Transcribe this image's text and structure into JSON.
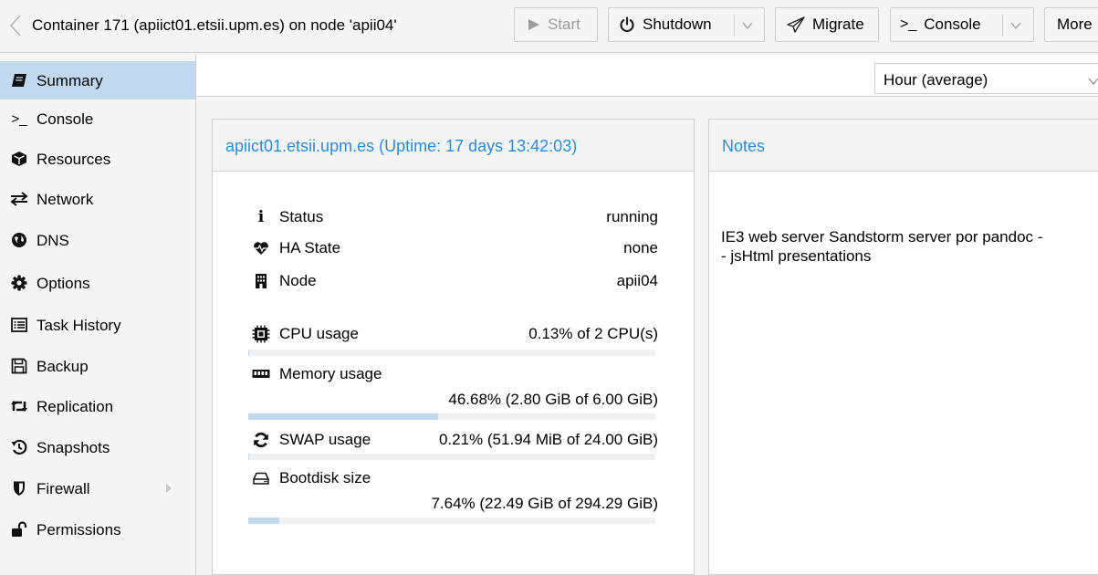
{
  "header": {
    "title": "Container 171 (apiict01.etsii.upm.es) on node 'apii04'",
    "buttons": {
      "start": "Start",
      "shutdown": "Shutdown",
      "migrate": "Migrate",
      "console": "Console",
      "more": "More"
    }
  },
  "sidebar": {
    "items": [
      {
        "label": "Summary",
        "icon": "book-icon"
      },
      {
        "label": "Console",
        "icon": "terminal-icon"
      },
      {
        "label": "Resources",
        "icon": "cube-icon"
      },
      {
        "label": "Network",
        "icon": "exchange-icon"
      },
      {
        "label": "DNS",
        "icon": "globe-icon"
      },
      {
        "label": "Options",
        "icon": "gear-icon"
      },
      {
        "label": "Task History",
        "icon": "list-icon"
      },
      {
        "label": "Backup",
        "icon": "floppy-icon"
      },
      {
        "label": "Replication",
        "icon": "retweet-icon"
      },
      {
        "label": "Snapshots",
        "icon": "history-icon"
      },
      {
        "label": "Firewall",
        "icon": "shield-icon"
      },
      {
        "label": "Permissions",
        "icon": "unlock-icon"
      }
    ],
    "active": "Summary"
  },
  "timeframe": {
    "selected": "Hour (average)"
  },
  "status_panel": {
    "title": "apiict01.etsii.upm.es (Uptime: 17 days 13:42:03)",
    "status": {
      "label": "Status",
      "value": "running"
    },
    "ha_state": {
      "label": "HA State",
      "value": "none"
    },
    "node": {
      "label": "Node",
      "value": "apii04"
    },
    "cpu": {
      "label": "CPU usage",
      "value": "0.13% of 2 CPU(s)",
      "percent": 0.13
    },
    "memory": {
      "label": "Memory usage",
      "value": "46.68% (2.80 GiB of 6.00 GiB)",
      "percent": 46.68
    },
    "swap": {
      "label": "SWAP usage",
      "value": "0.21% (51.94 MiB of 24.00 GiB)",
      "percent": 0.21
    },
    "bootdisk": {
      "label": "Bootdisk size",
      "value": "7.64% (22.49 GiB of 294.29 GiB)",
      "percent": 7.64
    }
  },
  "notes_panel": {
    "title": "Notes",
    "text": "IE3 web server Sandstorm server por pandoc -\n- jsHtml presentations"
  },
  "colors": {
    "accent_blue": "#2f8ad6",
    "selected_bg": "#c0d9ef",
    "border": "#cfcfcf",
    "background": "#f5f5f5",
    "disabled_text": "#9c9c9c"
  }
}
